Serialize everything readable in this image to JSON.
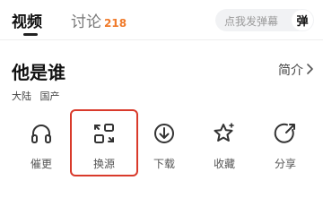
{
  "tabs": {
    "video_label": "视频",
    "discuss_label": "讨论",
    "discuss_count": "218"
  },
  "danmaku": {
    "placeholder": "点我发弹幕",
    "button_label": "弹"
  },
  "title": "他是谁",
  "intro_label": "简介",
  "meta": [
    "大陆",
    "国产"
  ],
  "actions": [
    {
      "label": "催更",
      "icon": "headphones-icon"
    },
    {
      "label": "换源",
      "icon": "switch-source-icon"
    },
    {
      "label": "下载",
      "icon": "download-icon"
    },
    {
      "label": "收藏",
      "icon": "star-icon"
    },
    {
      "label": "分享",
      "icon": "share-icon"
    }
  ],
  "colors": {
    "accent": "#f07a2a",
    "highlight": "#d93a2b"
  }
}
